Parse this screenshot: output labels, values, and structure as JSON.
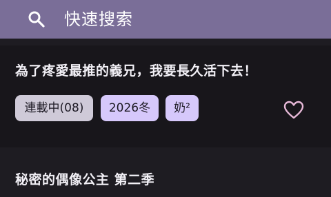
{
  "search": {
    "label": "快速搜索",
    "icon": "search-icon"
  },
  "results": [
    {
      "title": "為了疼愛最推的義兄，我要長久活下去！",
      "tags": [
        "連載中(08)",
        "2026冬",
        "奶²"
      ],
      "favorite_icon": "heart-outline-icon"
    },
    {
      "title": "秘密的偶像公主 第二季"
    }
  ],
  "colors": {
    "header_bg": "#7a6e98",
    "card_bg": "#18161b",
    "status_tag_bg": "#cfcad8",
    "tag_bg": "#d6c8fb",
    "heart": "#e7b9d8"
  }
}
